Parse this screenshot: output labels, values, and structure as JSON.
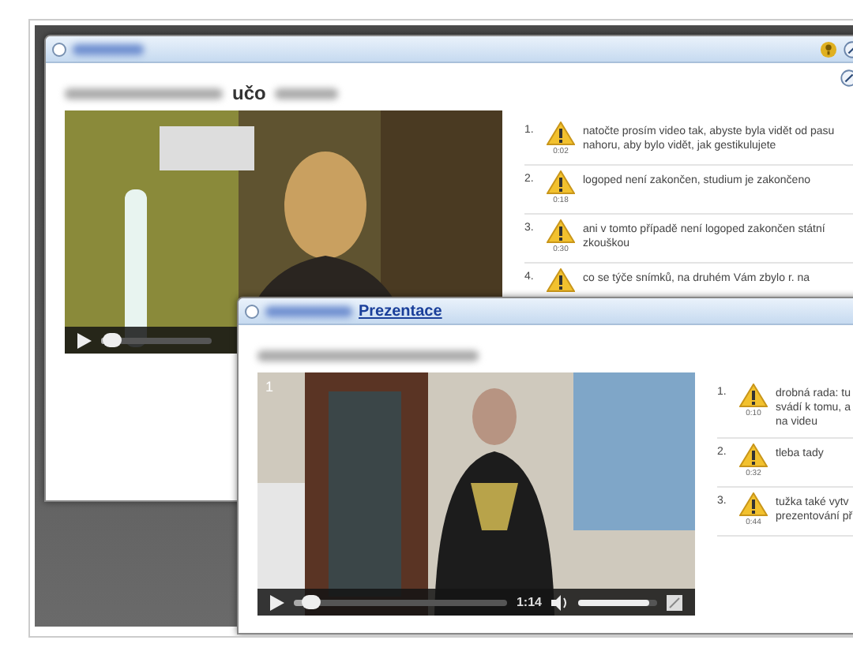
{
  "windows": [
    {
      "kind": "main",
      "header": "učo",
      "video": {
        "seek": {
          "level": 0.04
        }
      },
      "comments": [
        {
          "number": "1.",
          "time": "0:02",
          "text": "natočte prosím video tak, abyste byla vidět od pasu nahoru, aby bylo vidět, jak gestikulujete"
        },
        {
          "number": "2.",
          "time": "0:18",
          "text": "logoped není zakončen, studium je zakončeno"
        },
        {
          "number": "3.",
          "time": "0:30",
          "text": "ani v tomto případě není logoped zakončen státní zkouškou"
        },
        {
          "number": "4.",
          "text": "co se týče snímků, na druhém Vám zbylo r. na"
        }
      ]
    },
    {
      "kind": "front",
      "title": "Prezentace",
      "video": {
        "number": "1",
        "seek": {
          "level": 0.05
        },
        "time": "1:14",
        "volume": {
          "level": 0.9
        }
      },
      "comments": [
        {
          "number": "1.",
          "time": "0:10",
          "text": "drobná rada: tu\nsvádí k tomu, a\nna videu"
        },
        {
          "number": "2.",
          "time": "0:32",
          "text": "tleba tady"
        },
        {
          "number": "3.",
          "time": "0:44",
          "text": "tužka také vytv\nprezentování př"
        }
      ]
    }
  ]
}
